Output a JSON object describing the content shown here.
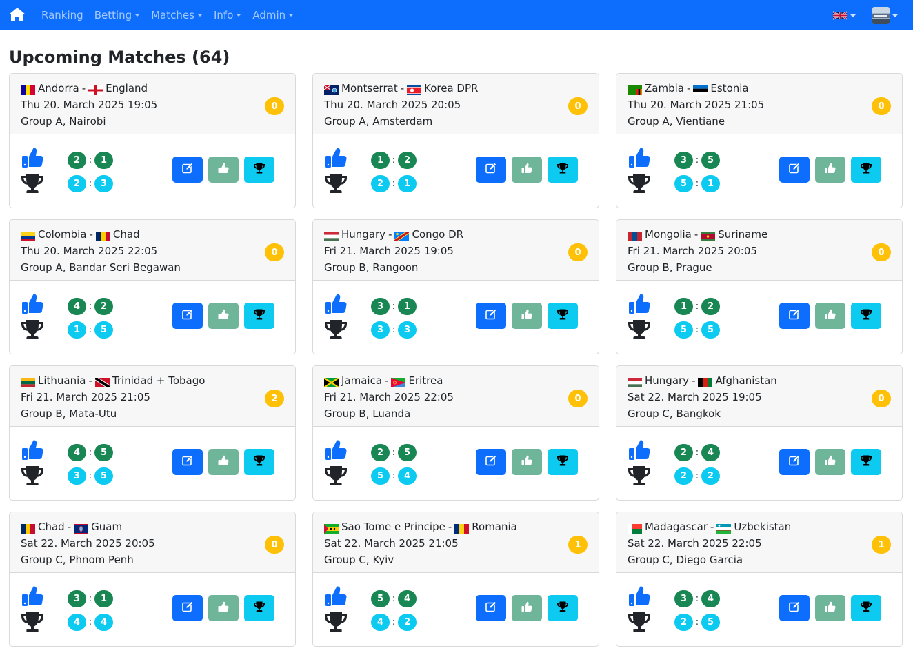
{
  "nav": {
    "items": [
      {
        "label": "Ranking",
        "dropdown": false
      },
      {
        "label": "Betting",
        "dropdown": true
      },
      {
        "label": "Matches",
        "dropdown": true
      },
      {
        "label": "Info",
        "dropdown": true
      },
      {
        "label": "Admin",
        "dropdown": true
      }
    ],
    "home_icon": "home-icon",
    "language_icon": "uk-flag-icon",
    "user_icon": "avatar"
  },
  "page": {
    "title": "Upcoming Matches (64)"
  },
  "colors": {
    "primary": "#0d6efd",
    "success": "#198754",
    "info": "#0dcaf0",
    "warning": "#ffc107",
    "like": "#6fb59a"
  },
  "matches": [
    {
      "home": "Andorra",
      "home_flag": "andorra",
      "away": "England",
      "away_flag": "england",
      "date": "Thu 20. March 2025 19:05",
      "group_venue": "Group A, Nairobi",
      "points": "0",
      "tip": [
        "2",
        "1"
      ],
      "result": [
        "2",
        "3"
      ]
    },
    {
      "home": "Montserrat",
      "home_flag": "montserrat",
      "away": "Korea DPR",
      "away_flag": "korea-dpr",
      "date": "Thu 20. March 2025 20:05",
      "group_venue": "Group A, Amsterdam",
      "points": "0",
      "tip": [
        "1",
        "2"
      ],
      "result": [
        "2",
        "1"
      ]
    },
    {
      "home": "Zambia",
      "home_flag": "zambia",
      "away": "Estonia",
      "away_flag": "estonia",
      "date": "Thu 20. March 2025 21:05",
      "group_venue": "Group A, Vientiane",
      "points": "0",
      "tip": [
        "3",
        "5"
      ],
      "result": [
        "5",
        "1"
      ]
    },
    {
      "home": "Colombia",
      "home_flag": "colombia",
      "away": "Chad",
      "away_flag": "chad",
      "date": "Thu 20. March 2025 22:05",
      "group_venue": "Group A, Bandar Seri Begawan",
      "points": "0",
      "tip": [
        "4",
        "2"
      ],
      "result": [
        "1",
        "5"
      ]
    },
    {
      "home": "Hungary",
      "home_flag": "hungary",
      "away": "Congo DR",
      "away_flag": "congo-dr",
      "date": "Fri 21. March 2025 19:05",
      "group_venue": "Group B, Rangoon",
      "points": "0",
      "tip": [
        "3",
        "1"
      ],
      "result": [
        "3",
        "3"
      ]
    },
    {
      "home": "Mongolia",
      "home_flag": "mongolia",
      "away": "Suriname",
      "away_flag": "suriname",
      "date": "Fri 21. March 2025 20:05",
      "group_venue": "Group B, Prague",
      "points": "0",
      "tip": [
        "1",
        "2"
      ],
      "result": [
        "5",
        "5"
      ]
    },
    {
      "home": "Lithuania",
      "home_flag": "lithuania",
      "away": "Trinidad + Tobago",
      "away_flag": "trinidad",
      "date": "Fri 21. March 2025 21:05",
      "group_venue": "Group B, Mata-Utu",
      "points": "2",
      "tip": [
        "4",
        "5"
      ],
      "result": [
        "3",
        "5"
      ]
    },
    {
      "home": "Jamaica",
      "home_flag": "jamaica",
      "away": "Eritrea",
      "away_flag": "eritrea",
      "date": "Fri 21. March 2025 22:05",
      "group_venue": "Group B, Luanda",
      "points": "0",
      "tip": [
        "2",
        "5"
      ],
      "result": [
        "5",
        "4"
      ]
    },
    {
      "home": "Hungary",
      "home_flag": "hungary",
      "away": "Afghanistan",
      "away_flag": "afghanistan",
      "date": "Sat 22. March 2025 19:05",
      "group_venue": "Group C, Bangkok",
      "points": "0",
      "tip": [
        "2",
        "4"
      ],
      "result": [
        "2",
        "2"
      ]
    },
    {
      "home": "Chad",
      "home_flag": "chad",
      "away": "Guam",
      "away_flag": "guam",
      "date": "Sat 22. March 2025 20:05",
      "group_venue": "Group C, Phnom Penh",
      "points": "0",
      "tip": [
        "3",
        "1"
      ],
      "result": [
        "4",
        "4"
      ]
    },
    {
      "home": "Sao Tome e Principe",
      "home_flag": "sao-tome",
      "away": "Romania",
      "away_flag": "romania",
      "date": "Sat 22. March 2025 21:05",
      "group_venue": "Group C, Kyiv",
      "points": "1",
      "tip": [
        "5",
        "4"
      ],
      "result": [
        "4",
        "2"
      ]
    },
    {
      "home": "Madagascar",
      "home_flag": "madagascar",
      "away": "Uzbekistan",
      "away_flag": "uzbekistan",
      "date": "Sat 22. March 2025 22:05",
      "group_venue": "Group C, Diego Garcia",
      "points": "1",
      "tip": [
        "3",
        "4"
      ],
      "result": [
        "2",
        "5"
      ]
    }
  ]
}
